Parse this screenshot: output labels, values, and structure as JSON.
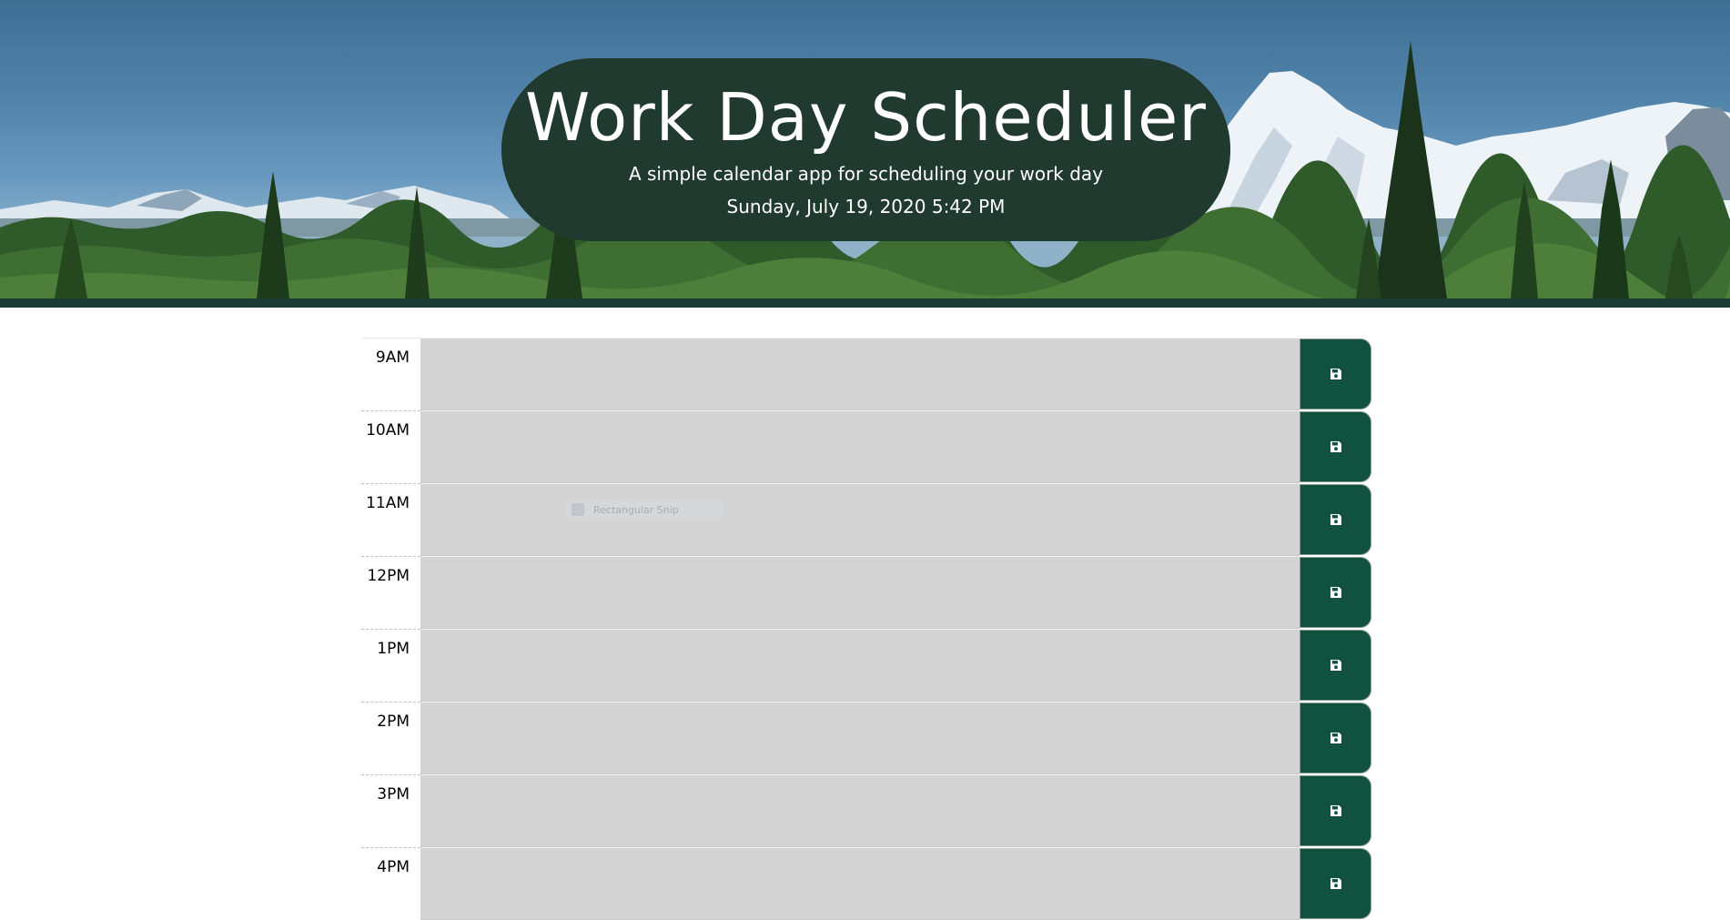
{
  "header": {
    "title": "Work Day Scheduler",
    "subtitle": "A simple calendar app for scheduling your work day",
    "current_day": "Sunday, July 19, 2020 5:42 PM"
  },
  "schedule": {
    "rows": [
      {
        "hour": "9AM",
        "text": ""
      },
      {
        "hour": "10AM",
        "text": ""
      },
      {
        "hour": "11AM",
        "text": ""
      },
      {
        "hour": "12PM",
        "text": ""
      },
      {
        "hour": "1PM",
        "text": ""
      },
      {
        "hour": "2PM",
        "text": ""
      },
      {
        "hour": "3PM",
        "text": ""
      },
      {
        "hour": "4PM",
        "text": ""
      }
    ],
    "save_icon": "floppy-disk-icon"
  },
  "overlay": {
    "snip_label": "Rectangular Snip"
  },
  "colors": {
    "header_pill": "#213a2f",
    "header_border": "#1b3d33",
    "save_button": "#10513f",
    "past_block": "#d3d3d3"
  }
}
